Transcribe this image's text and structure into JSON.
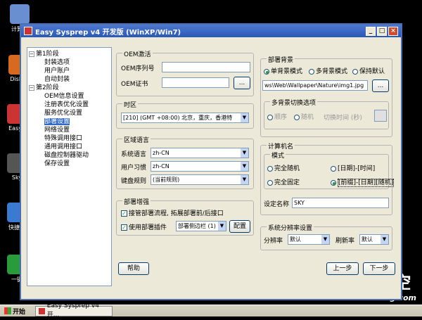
{
  "desktop": {
    "icons": [
      {
        "label": "计算机"
      },
      {
        "label": "DiskG"
      },
      {
        "label": "Easy I"
      },
      {
        "label": "Sky"
      },
      {
        "label": "快捷装"
      },
      {
        "label": "一键"
      }
    ],
    "watermark_main": "IT天空",
    "watermark_sub": "iTiankong.com"
  },
  "window": {
    "title": "Easy Sysprep v4 开发版 (WinXP/Win7)",
    "min": "_",
    "max": "□",
    "close": "×"
  },
  "tree": {
    "items": [
      {
        "label": "第1阶段",
        "level": 1,
        "expander": "−"
      },
      {
        "label": "封装选项",
        "level": 2
      },
      {
        "label": "用户账户",
        "level": 2
      },
      {
        "label": "自动封装",
        "level": 2
      },
      {
        "label": "第2阶段",
        "level": 1,
        "expander": "−"
      },
      {
        "label": "OEM信息设置",
        "level": 2
      },
      {
        "label": "注册表优化设置",
        "level": 2
      },
      {
        "label": "服务优化设置",
        "level": 2
      },
      {
        "label": "部署设置",
        "level": 2,
        "selected": true
      },
      {
        "label": "网络设置",
        "level": 2
      },
      {
        "label": "特殊调用接口",
        "level": 2
      },
      {
        "label": "通用调用接口",
        "level": 2
      },
      {
        "label": "磁盘控制器驱动",
        "level": 2
      },
      {
        "label": "保存设置",
        "level": 2
      }
    ]
  },
  "oem": {
    "legend": "OEM激活",
    "serial_label": "OEM序列号",
    "serial_value": "",
    "cert_label": "OEM证书",
    "cert_value": "",
    "browse": "..."
  },
  "timezone": {
    "legend": "时区",
    "value": "[210] (GMT +08:00) 北京，重庆，香港特"
  },
  "region": {
    "legend": "区域语言",
    "sys_lang_label": "系统语言",
    "sys_lang": "zh-CN",
    "user_locale_label": "用户习惯",
    "user_locale": "zh-CN",
    "keyboard_label": "键盘规则",
    "keyboard": "(当前规则)"
  },
  "deploy_enh": {
    "legend": "部署增强",
    "takeover_label": "接管部署流程, 拓展部署前/后接口",
    "plugin_label": "使用部署插件",
    "plugin_select": "部署侧边栏 (1)",
    "config_button": "配置"
  },
  "background": {
    "legend": "部署背景",
    "single": "单背景模式",
    "multi": "多背景模式",
    "keep_default": "保持默认",
    "path": "ws\\Web\\Wallpaper\\Nature\\img1.jpg",
    "browse": "...",
    "switch_legend": "多背景切换选项",
    "order": "顺序",
    "random": "随机",
    "switch_time": "切换时间 (秒)"
  },
  "computer_name": {
    "legend": "计算机名",
    "mode_legend": "模式",
    "full_random": "完全随机",
    "date_time": "[日期]-[时间]",
    "full_fixed": "完全固定",
    "prefix_date_random": "[前缀]-[日期][随机]",
    "set_name_label": "设定名称",
    "set_name_value": "SKY"
  },
  "resolution": {
    "legend": "系统分辨率设置",
    "res_label": "分辨率",
    "res_value": "默认",
    "refresh_label": "刷新率",
    "refresh_value": "默认"
  },
  "buttons": {
    "help": "帮助",
    "prev": "上一步",
    "next": "下一步"
  },
  "taskbar": {
    "start": "开始",
    "task": "Easy Sysprep v4 开..."
  },
  "colors": {
    "title_bar": "#2a58b8",
    "window_bg": "#ece9d8",
    "selected": "#316ac5"
  }
}
